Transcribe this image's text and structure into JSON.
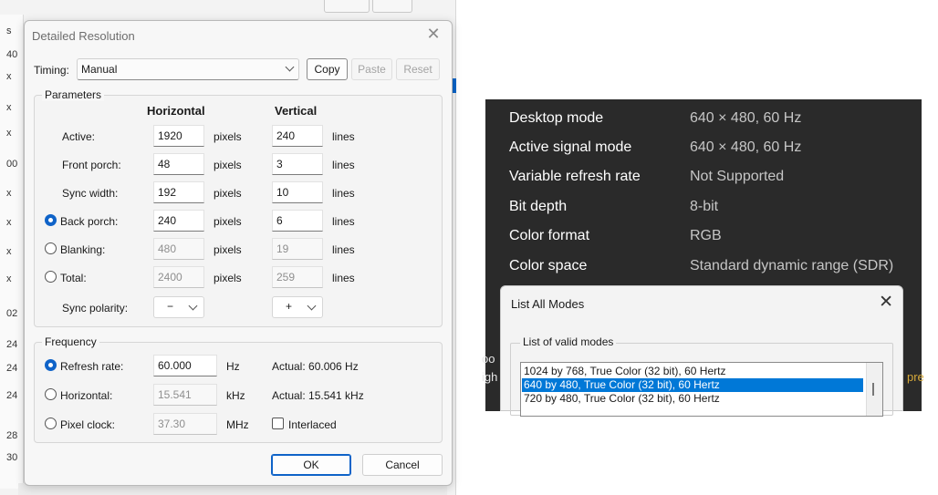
{
  "background_window": {
    "edge_glyphs": [
      "s",
      "40",
      "x",
      "x",
      "x",
      "00",
      "x",
      "x",
      "x",
      "x",
      "02",
      "24",
      "24",
      "24",
      "28",
      "30"
    ]
  },
  "cru_dialog": {
    "title": "Detailed Resolution",
    "close_glyph": "✕",
    "timing_label": "Timing:",
    "timing_value": "Manual",
    "buttons": {
      "copy": "Copy",
      "paste": "Paste",
      "reset": "Reset",
      "ok": "OK",
      "cancel": "Cancel"
    },
    "parameters": {
      "group_label": "Parameters",
      "horizontal_header": "Horizontal",
      "vertical_header": "Vertical",
      "rows": [
        {
          "label": "Active:",
          "h_value": "1920",
          "h_unit": "pixels",
          "v_value": "240",
          "v_unit": "lines",
          "radio": null,
          "dim": false
        },
        {
          "label": "Front porch:",
          "h_value": "48",
          "h_unit": "pixels",
          "v_value": "3",
          "v_unit": "lines",
          "radio": null,
          "dim": false
        },
        {
          "label": "Sync width:",
          "h_value": "192",
          "h_unit": "pixels",
          "v_value": "10",
          "v_unit": "lines",
          "radio": null,
          "dim": false
        },
        {
          "label": "Back porch:",
          "h_value": "240",
          "h_unit": "pixels",
          "v_value": "6",
          "v_unit": "lines",
          "radio": "on",
          "dim": false
        },
        {
          "label": "Blanking:",
          "h_value": "480",
          "h_unit": "pixels",
          "v_value": "19",
          "v_unit": "lines",
          "radio": "off",
          "dim": true
        },
        {
          "label": "Total:",
          "h_value": "2400",
          "h_unit": "pixels",
          "v_value": "259",
          "v_unit": "lines",
          "radio": "off",
          "dim": true
        }
      ],
      "sync_polarity_label": "Sync polarity:",
      "h_polarity": "−",
      "v_polarity": "+"
    },
    "frequency": {
      "group_label": "Frequency",
      "rows": [
        {
          "label": "Refresh rate:",
          "value": "60.000",
          "unit": "Hz",
          "actual": "Actual: 60.006 Hz",
          "radio": "on",
          "dim": false
        },
        {
          "label": "Horizontal:",
          "value": "15.541",
          "unit": "kHz",
          "actual": "Actual: 15.541 kHz",
          "radio": "off",
          "dim": true
        },
        {
          "label": "Pixel clock:",
          "value": "37.30",
          "unit": "MHz",
          "actual": "",
          "radio": "off",
          "dim": true
        }
      ],
      "interlaced_label": "Interlaced",
      "interlaced_checked": false
    }
  },
  "display_info": {
    "rows": [
      {
        "key": "Desktop mode",
        "value": "640 × 480, 60 Hz"
      },
      {
        "key": "Active signal mode",
        "value": "640 × 480, 60 Hz"
      },
      {
        "key": "Variable refresh rate",
        "value": "Not Supported"
      },
      {
        "key": "Bit depth",
        "value": "8-bit"
      },
      {
        "key": "Color format",
        "value": "RGB"
      },
      {
        "key": "Color space",
        "value": "Standard dynamic range (SDR)"
      }
    ],
    "side_fragments": {
      "left_top": "oo",
      "left_bottom": "igh",
      "right": "pre"
    }
  },
  "list_all_modes": {
    "title": "List All Modes",
    "close_glyph": "✕",
    "group_label": "List of valid modes",
    "items": [
      {
        "text": "1024 by 768, True Color (32 bit), 60 Hertz",
        "selected": false
      },
      {
        "text": "640 by 480, True Color (32 bit), 60 Hertz",
        "selected": true
      },
      {
        "text": "720 by 480, True Color (32 bit), 60 Hertz",
        "selected": false
      }
    ]
  },
  "colors": {
    "accent": "#0f63c8",
    "selection": "#0078d7",
    "dark_panel": "#2a2a2a"
  }
}
